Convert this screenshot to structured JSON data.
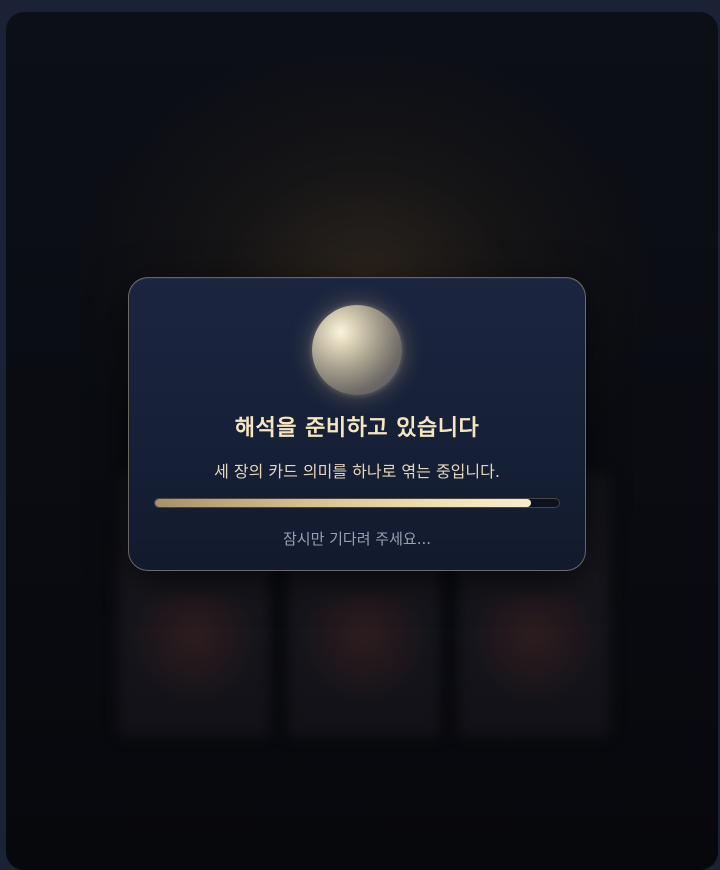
{
  "loading_dialog": {
    "title": "해석을 준비하고 있습니다",
    "subtitle": "세 장의 카드 의미를 하나로 엮는 중입니다.",
    "wait_text": "잠시만 기다려 주세요...",
    "progress_fraction": 0.93,
    "orb_icon": "crystal-orb-icon"
  },
  "background": {
    "cards": [
      "tarot-card-1",
      "tarot-card-2",
      "tarot-card-3"
    ]
  },
  "colors": {
    "accent_gold": "#f6e6c0",
    "dialog_bg": "#1b2540",
    "page_bg": "#0a0c12"
  }
}
